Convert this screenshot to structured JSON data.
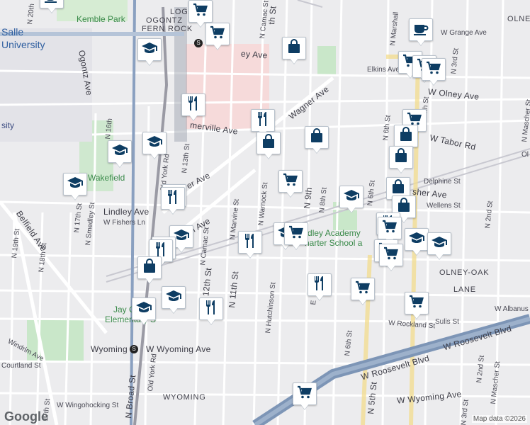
{
  "map": {
    "attribution": "Map data ©2026",
    "logo": "Google",
    "labels": {
      "areas": {
        "logan": "LOGAN",
        "ogontz": "OGONTZ",
        "fern_rock": "FERN ROCK",
        "olney": "OLNEY",
        "olney_oak": "OLNEY-OAK",
        "lane": "LANE",
        "wyoming_area": "WYOMING"
      },
      "poi": {
        "kemble_park": "Kemble Park",
        "salle": "Salle",
        "university": "University",
        "wakefield": "Wakefield",
        "lindley_academy_1": "Lindley Academy",
        "lindley_academy_2": "harter School a",
        "jay_elem_1": "Jay C",
        "jay_elem_2": "Elementary S",
        "sity": "sity"
      },
      "streets": {
        "ogontz_ave": "Ogontz Ave",
        "olney_ave_w": "W Olney Ave",
        "olney_ave_frag": "ey Ave",
        "elkins_ave": "Elkins Ave",
        "grange_ave": "W Grange Ave",
        "tabor_rd": "W Tabor Rd",
        "wagner_ave": "Wagner Ave",
        "somerville_ave": "merville Ave",
        "wagner_frag": "er Ave",
        "delphine_st": "Delphine St",
        "fisher_ave": "sher Ave",
        "wellens_st": "Wellens St",
        "lindley_ave": "Lindley Ave",
        "w_fishers_ln": "W Fishers Ln",
        "windrim_frag": "drim Ave",
        "windrim_ave": "Windrim Ave",
        "belfield_ave": "Belfield Ave",
        "wyoming_w": "W Wyoming Ave",
        "wyoming_station": "Wyoming",
        "wyoming_e": "W Wyoming Ave",
        "roosevelt_1": "W Roosevelt Blvd",
        "roosevelt_2": "W Roosevelt Blvd",
        "rockland_st": "W Rockland St",
        "sulis_st": "Sulis St",
        "albanus_st": "W Albanus",
        "courtland_st": "Courtland St",
        "wingohocking": "W Wingohocking St",
        "n_broad_st": "N Broad St",
        "old_york_1": "Old York Rd",
        "old_york_2": "Old York Rd",
        "n_12th_st": "N 12th St",
        "n_11th_st": "N 11th St",
        "n_13th_st": "N 13th St",
        "n_camac_1": "N Camac St",
        "n_camac_2": "N Camac St",
        "n_marvine": "N Marvine St",
        "n_warnock": "N Warnock St",
        "n_hutchinson": "N Hutchinson St",
        "n_9th": "N 9th",
        "n_8th": "N 8th St",
        "n_6th_1": "N 6th St",
        "n_6th_2": "N 6th St",
        "n_6th_3": "N 6th St",
        "n_5th": "N 5th St",
        "n_4th": "N 4th St",
        "n_3rd_1": "N 3rd St",
        "n_3rd_2": "N 3rd St",
        "n_2nd_1": "N 2nd St",
        "n_2nd_2": "N 2nd St",
        "n_mascher_1": "N Mascher St",
        "n_mascher_2": "N Mascher St",
        "n_marshall": "N Marshall",
        "n_16th_1": "N 16th",
        "n_17th": "N 17th St",
        "n_18th": "N 18th St",
        "n_19th": "N 19th St",
        "n_smedley": "N Smedley St",
        "n_20th": "N 20th",
        "n_17th_b": "17th St",
        "n_ith": "th St",
        "n_e": "E",
        "ol": "Ol",
        "olne": "OLNE",
        "n_6th_4": "N 6th St",
        "w_roosevelt_frag": "W Roosevelt Blvd"
      }
    },
    "marker_icons": [
      "cart-icon",
      "shopping-bag-icon",
      "restaurant-icon",
      "school-icon",
      "coffee-icon"
    ]
  }
}
